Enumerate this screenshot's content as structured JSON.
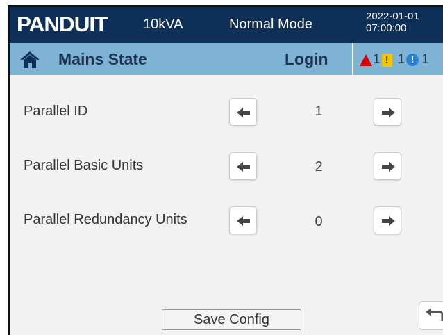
{
  "header": {
    "brand": "PANDUIT",
    "rating": "10kVA",
    "mode": "Normal Mode",
    "date": "2022-01-01",
    "time": "07:00:00"
  },
  "titlebar": {
    "title": "Mains State",
    "login_label": "Login",
    "alarm_critical_count": "1",
    "alarm_warning_count": "1",
    "alarm_info_count": "1",
    "icons": [
      "home-icon",
      "critical-alarm-icon",
      "warning-alarm-icon",
      "info-alarm-icon"
    ]
  },
  "rows": [
    {
      "label": "Parallel ID",
      "value": "1"
    },
    {
      "label": "Parallel Basic Units",
      "value": "2"
    },
    {
      "label": "Parallel Redundancy Units",
      "value": "0"
    }
  ],
  "footer": {
    "save_label": "Save Config",
    "back_icon": "back-icon"
  },
  "colors": {
    "header_bg": "#0e2f57",
    "titlebar_bg": "#7fb3d6",
    "content_bg": "#f2f2f2",
    "critical": "#d80000",
    "warning": "#f5c400",
    "info": "#2c7fd6"
  }
}
